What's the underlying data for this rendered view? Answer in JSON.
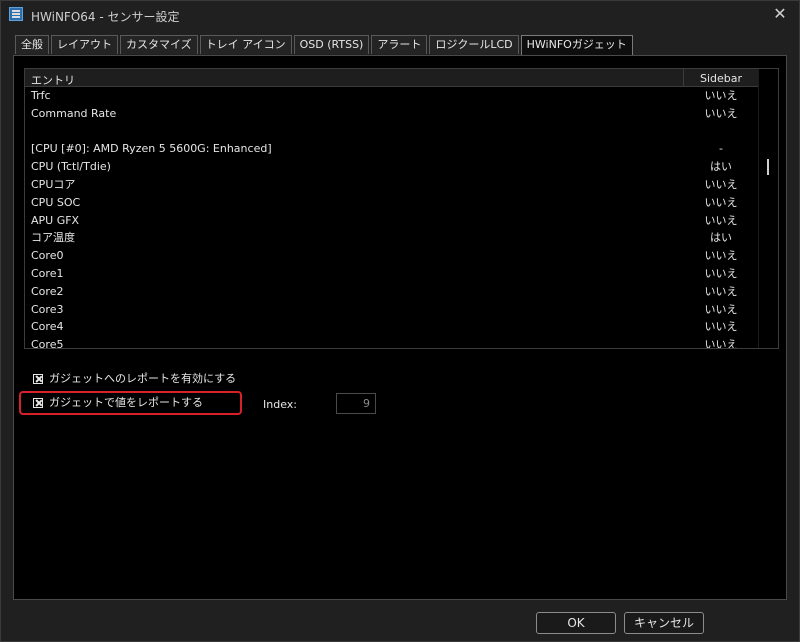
{
  "window": {
    "title": "HWiNFO64 - センサー設定"
  },
  "tabs": [
    {
      "label": "全般"
    },
    {
      "label": "レイアウト"
    },
    {
      "label": "カスタマイズ"
    },
    {
      "label": "トレイ アイコン"
    },
    {
      "label": "OSD (RTSS)"
    },
    {
      "label": "アラート"
    },
    {
      "label": "ロジクールLCD"
    },
    {
      "label": "HWiNFOガジェット",
      "active": true
    }
  ],
  "list": {
    "columns": {
      "entry": "エントリ",
      "sidebar": "Sidebar"
    },
    "rows": [
      {
        "entry": "Trfc",
        "sidebar": "いいえ"
      },
      {
        "entry": "Command Rate",
        "sidebar": "いいえ"
      },
      {
        "entry": "",
        "sidebar": ""
      },
      {
        "entry": "[CPU [#0]: AMD Ryzen 5 5600G: Enhanced]",
        "sidebar": "-"
      },
      {
        "entry": "CPU (Tctl/Tdie)",
        "sidebar": "はい"
      },
      {
        "entry": "CPUコア",
        "sidebar": "いいえ"
      },
      {
        "entry": "CPU SOC",
        "sidebar": "いいえ"
      },
      {
        "entry": "APU GFX",
        "sidebar": "いいえ"
      },
      {
        "entry": "コア温度",
        "sidebar": "はい"
      },
      {
        "entry": "Core0",
        "sidebar": "いいえ"
      },
      {
        "entry": "Core1",
        "sidebar": "いいえ"
      },
      {
        "entry": "Core2",
        "sidebar": "いいえ"
      },
      {
        "entry": "Core3",
        "sidebar": "いいえ"
      },
      {
        "entry": "Core4",
        "sidebar": "いいえ"
      },
      {
        "entry": "Core5",
        "sidebar": "いいえ"
      }
    ]
  },
  "options": {
    "enable_gadget_report": {
      "label": "ガジェットへのレポートを有効にする",
      "checked": true
    },
    "report_value": {
      "label": "ガジェットで値をレポートする",
      "checked": true
    },
    "index_label": "Index:",
    "index_value": "9"
  },
  "buttons": {
    "ok": "OK",
    "cancel": "キャンセル"
  },
  "colors": {
    "highlight": "#d8202a",
    "background": "#000000",
    "panel_border": "#4a4a4a"
  }
}
